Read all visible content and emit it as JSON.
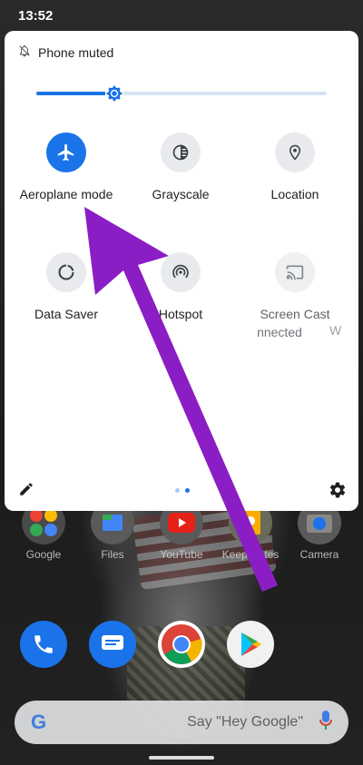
{
  "status_bar": {
    "time": "13:52"
  },
  "quick_settings": {
    "header_text": "Phone muted",
    "brightness_level": 0.27,
    "tiles": [
      {
        "label": "Aeroplane mode",
        "icon": "airplane-icon",
        "active": true
      },
      {
        "label": "Grayscale",
        "icon": "grayscale-icon",
        "active": false
      },
      {
        "label": "Location",
        "icon": "location-pin-icon",
        "active": false
      },
      {
        "label": "Data Saver",
        "icon": "data-saver-icon",
        "active": false
      },
      {
        "label": "Hotspot",
        "icon": "hotspot-icon",
        "active": false
      },
      {
        "label": "Screen Cast",
        "sublabel": "nnected",
        "icon": "cast-icon",
        "active": false
      }
    ],
    "partial_tile_label": "W",
    "page_indicator": {
      "pages": 2,
      "current": 2
    }
  },
  "home_screen": {
    "row1": [
      {
        "label": "Google",
        "icon": "google-folder-icon"
      },
      {
        "label": "Files",
        "icon": "files-icon"
      },
      {
        "label": "YouTube",
        "icon": "youtube-icon"
      },
      {
        "label": "Keep Notes",
        "icon": "keep-notes-icon"
      },
      {
        "label": "Camera",
        "icon": "camera-icon"
      }
    ],
    "dock": [
      {
        "icon": "phone-icon"
      },
      {
        "icon": "messages-icon"
      },
      {
        "icon": "chrome-icon"
      },
      {
        "icon": "play-store-icon"
      }
    ],
    "search_bar": {
      "logo": "G",
      "hint": "Say \"Hey Google\""
    }
  },
  "colors": {
    "accent": "#1a73e8",
    "annotation_arrow": "#8a1ec4",
    "panel_background": "#ffffff"
  }
}
